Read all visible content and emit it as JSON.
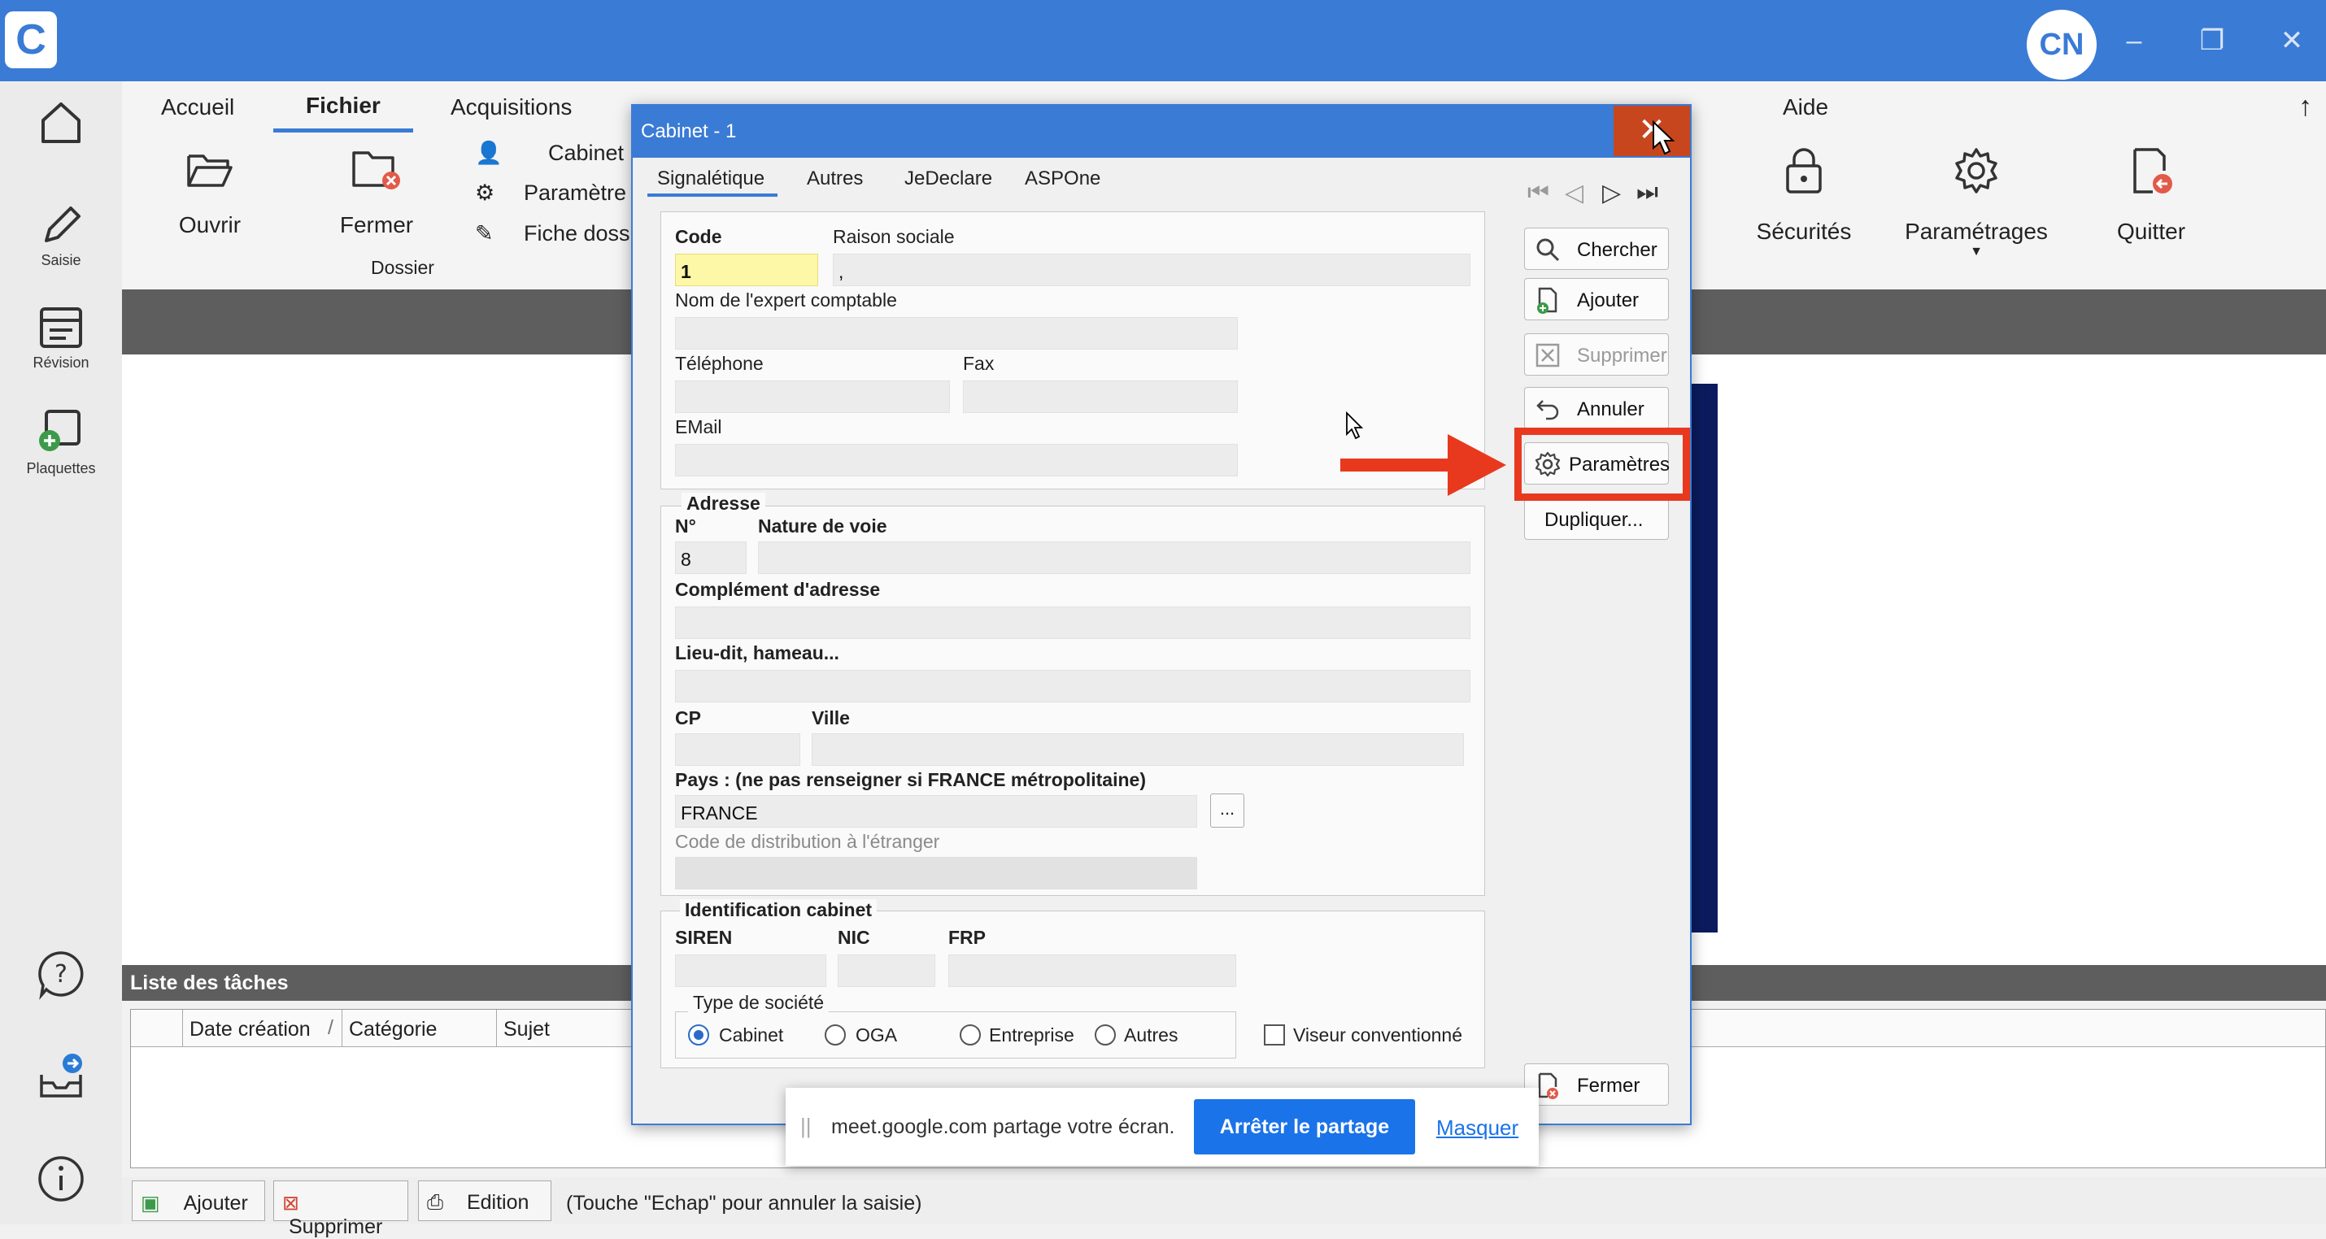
{
  "app": {
    "logo_letter": "C",
    "avatar_initials": "CN"
  },
  "window_controls": {
    "minimize": "–",
    "restore": "❐",
    "close": "✕"
  },
  "leftrail": {
    "items": [
      {
        "label": "",
        "icon": "home-icon"
      },
      {
        "label": "Saisie",
        "icon": "pencil-icon"
      },
      {
        "label": "Révision",
        "icon": "revision-icon"
      },
      {
        "label": "Plaquettes",
        "icon": "plaquettes-icon"
      }
    ],
    "bottom_icons": [
      "help-icon",
      "inbox-icon",
      "info-icon"
    ]
  },
  "menu": {
    "tabs": [
      "Accueil",
      "Fichier",
      "Acquisitions",
      "Aide"
    ],
    "active": "Fichier"
  },
  "ribbon": {
    "open_label": "Ouvrir",
    "close_label": "Fermer",
    "group_label": "Dossier",
    "small_items": [
      "Cabinet",
      "Paramètre",
      "Fiche doss"
    ],
    "right_items": [
      "Sécurités",
      "Paramétrages",
      "Quitter"
    ]
  },
  "tasks": {
    "title": "Liste des tâches",
    "columns": [
      "Date création",
      "Catégorie",
      "Sujet"
    ],
    "sort_marker": "/",
    "bottom_buttons": [
      "Ajouter",
      "Supprimer",
      "Edition"
    ],
    "hint": "(Touche \"Echap\" pour annuler la saisie)"
  },
  "dialog": {
    "title": "Cabinet - 1",
    "tabs": [
      "Signalétique",
      "Autres",
      "JeDeclare",
      "ASPOne"
    ],
    "active_tab": "Signalétique",
    "fields": {
      "code_label": "Code",
      "code_value": "1",
      "raison_label": "Raison sociale",
      "raison_value": ",",
      "expert_label": "Nom de l'expert comptable",
      "tel_label": "Téléphone",
      "fax_label": "Fax",
      "email_label": "EMail"
    },
    "address": {
      "group": "Adresse",
      "num_label": "N°",
      "num_value": "8",
      "voie_label": "Nature de voie",
      "complement_label": "Complément d'adresse",
      "lieudit_label": "Lieu-dit, hameau...",
      "cp_label": "CP",
      "ville_label": "Ville",
      "pays_label": "Pays : (ne pas renseigner si FRANCE métropolitaine)",
      "pays_value": "FRANCE",
      "pays_btn": "...",
      "distrib_label": "Code de distribution à l'étranger"
    },
    "ident": {
      "group": "Identification cabinet",
      "siren_label": "SIREN",
      "nic_label": "NIC",
      "frp_label": "FRP",
      "type_group": "Type de société",
      "types": [
        "Cabinet",
        "OGA",
        "Entreprise",
        "Autres"
      ],
      "selected_type": "Cabinet",
      "viseur_label": "Viseur conventionné"
    },
    "side_buttons": [
      "Chercher",
      "Ajouter",
      "Supprimer",
      "Annuler",
      "Paramètres",
      "Dupliquer...",
      "Fermer"
    ]
  },
  "share_banner": {
    "handle": "||",
    "message": "meet.google.com partage votre écran.",
    "stop": "Arrêter le partage",
    "hide": "Masquer"
  },
  "colors": {
    "titlebar": "#3a7bd5",
    "annotation_red": "#e8391f",
    "close_btn": "#c8461e",
    "code_field": "#fdf7a8"
  }
}
